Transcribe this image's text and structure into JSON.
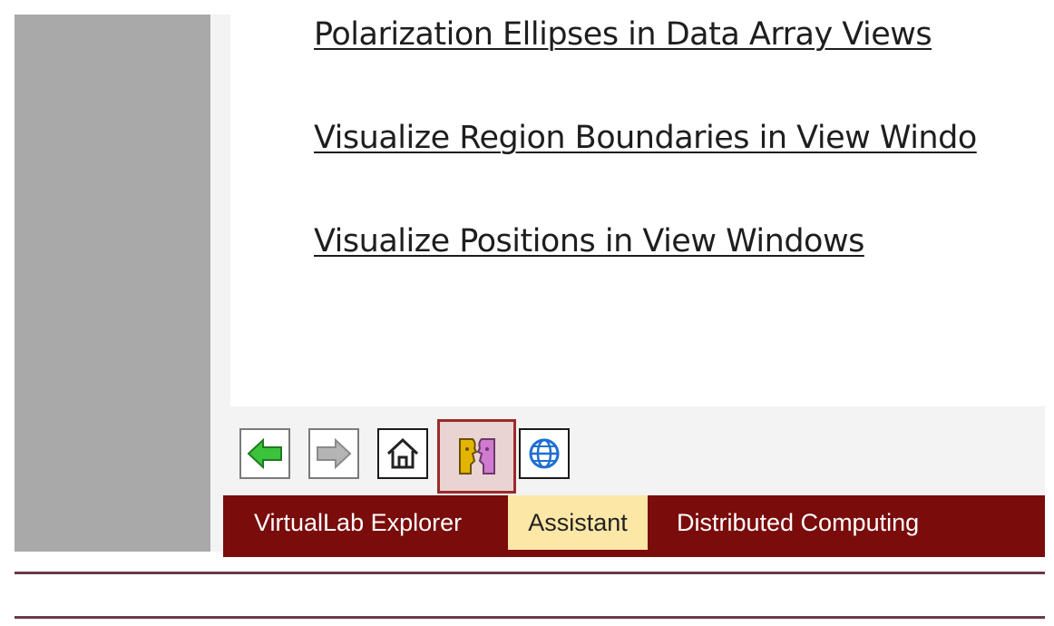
{
  "links": [
    "Polarization Ellipses in Data Array Views",
    "Visualize Region Boundaries in View Windo",
    "Visualize Positions in View Windows"
  ],
  "toolbar": {
    "buttons": [
      {
        "name": "back-arrow-icon",
        "color": "#3cc33c"
      },
      {
        "name": "forward-arrow-icon",
        "color": "#b5b5b5"
      },
      {
        "name": "home-icon"
      },
      {
        "name": "assistant-faces-icon",
        "color_left": "#e3b500",
        "color_right": "#d07ad0"
      },
      {
        "name": "globe-icon",
        "color": "#1f6fd0"
      }
    ]
  },
  "tabs": {
    "explorer": "VirtualLab Explorer",
    "assistant": "Assistant",
    "distributed": "Distributed Computing",
    "active": "Assistant"
  },
  "colors": {
    "tab_bar": "#7a0c0c",
    "active_tab": "#fde7a6",
    "active_button_border": "#9c2a2a"
  }
}
